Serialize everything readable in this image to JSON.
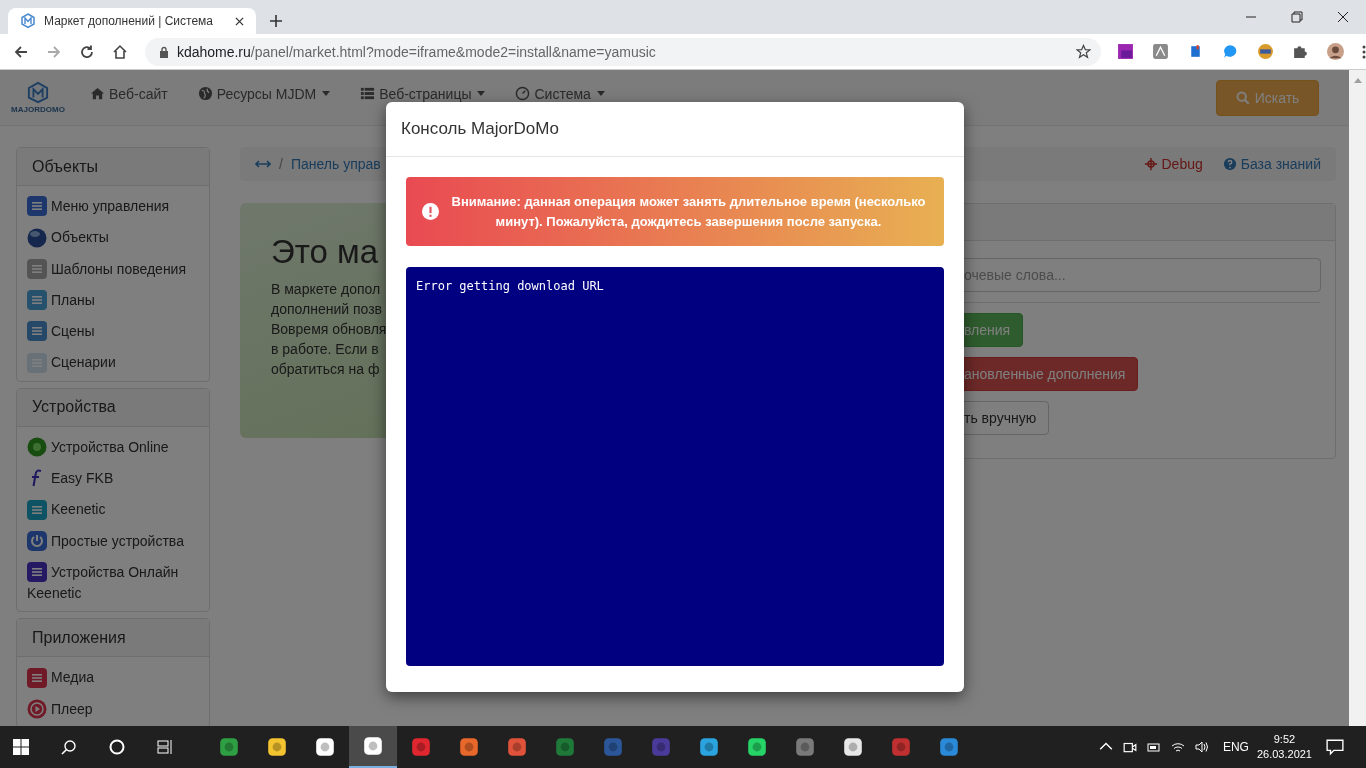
{
  "browser": {
    "tab": {
      "title": "Маркет дополнений | Система",
      "selected": true
    },
    "address": {
      "host": "kdahome.ru",
      "path": "/panel/market.html?mode=iframe&mode2=install&name=yamusic"
    }
  },
  "navbar": {
    "logo_text": "MAJORDOMO",
    "items": [
      {
        "label": "Веб-сайт",
        "dropdown": false
      },
      {
        "label": "Ресурсы MJDM",
        "dropdown": true
      },
      {
        "label": "Веб-страницы",
        "dropdown": true
      },
      {
        "label": "Система",
        "dropdown": true
      }
    ],
    "search_button": "Искать"
  },
  "sidebar": [
    {
      "title": "Объекты",
      "items": [
        "Меню управления",
        "Объекты",
        "Шаблоны поведения",
        "Планы",
        "Сцены",
        "Сценарии"
      ]
    },
    {
      "title": "Устройства",
      "items": [
        "Устройства Online",
        "Easy FKB",
        "Keenetic",
        "Простые устройства",
        "Устройства Онлайн Keenetic"
      ]
    },
    {
      "title": "Приложения",
      "items": [
        "Медиа",
        "Плеер"
      ]
    }
  ],
  "breadcrumb": {
    "separator": "/",
    "item": "Панель управ",
    "links": [
      {
        "kind": "debug",
        "label": "Debug"
      },
      {
        "kind": "help",
        "label": "База знаний"
      }
    ]
  },
  "jumbotron": {
    "title": "Это ма",
    "lines": [
      "В маркете допол",
      "дополнений позв",
      "Вовремя обновля",
      "в работе. Если в",
      "обратиться на ф"
    ]
  },
  "market_panel": {
    "search_placeholder": "очевые слова...",
    "buttons": [
      {
        "kind": "success",
        "label": "вления"
      },
      {
        "kind": "danger",
        "label": "ановленные дополнения"
      },
      {
        "kind": "default",
        "label": "ть вручную"
      }
    ]
  },
  "modal": {
    "title": "Консоль MajorDoMo",
    "warning": "Внимание: данная операция может занять длительное время (несколько минут). Пожалуйста, дождитесь завершения после запуска.",
    "console_output": "Error getting download URL"
  },
  "taskbar": {
    "apps": [
      {
        "selected": false
      },
      {
        "selected": false
      },
      {
        "selected": false
      },
      {
        "selected": true
      },
      {
        "selected": false
      },
      {
        "selected": false
      },
      {
        "selected": false
      },
      {
        "selected": false
      },
      {
        "selected": false
      },
      {
        "selected": false
      },
      {
        "selected": false
      },
      {
        "selected": false
      },
      {
        "selected": false
      },
      {
        "selected": false
      },
      {
        "selected": false
      },
      {
        "selected": false
      }
    ],
    "language": "ENG",
    "time": "9:52",
    "date": "26.03.2021"
  }
}
